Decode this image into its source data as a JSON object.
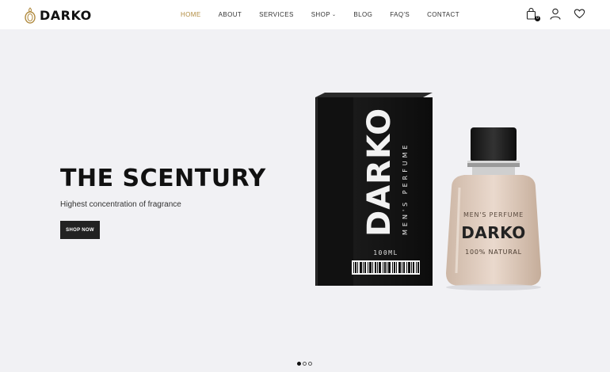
{
  "brand": {
    "name": "DARKO"
  },
  "nav": {
    "items": [
      {
        "label": "HOME",
        "active": true
      },
      {
        "label": "ABOUT",
        "active": false
      },
      {
        "label": "SERVICES",
        "active": false
      },
      {
        "label": "SHOP",
        "active": false,
        "has_dropdown": true
      },
      {
        "label": "BLOG",
        "active": false
      },
      {
        "label": "FAQ'S",
        "active": false
      },
      {
        "label": "CONTACT",
        "active": false
      }
    ],
    "active_color": "#b08a3e"
  },
  "header_icons": {
    "cart": {
      "icon": "shopping-bag-icon",
      "badge": "0"
    },
    "account": {
      "icon": "user-icon"
    },
    "wishlist": {
      "icon": "heart-icon"
    }
  },
  "hero": {
    "title": "THE SCENTURY",
    "subtitle": "Highest concentration of fragrance",
    "button_label": "SHOP NOW"
  },
  "product": {
    "box_brand": "DARKO",
    "box_tagline": "MEN'S PERFUME",
    "box_volume": "100ML",
    "bottle_tagline": "MEN'S PERFUME",
    "bottle_brand": "DARKO",
    "bottle_claim": "100% NATURAL"
  },
  "slider": {
    "count": 3,
    "active_index": 0
  },
  "colors": {
    "background": "#f1f1f4",
    "header": "#ffffff",
    "button": "#222222",
    "accent": "#b08a3e"
  }
}
